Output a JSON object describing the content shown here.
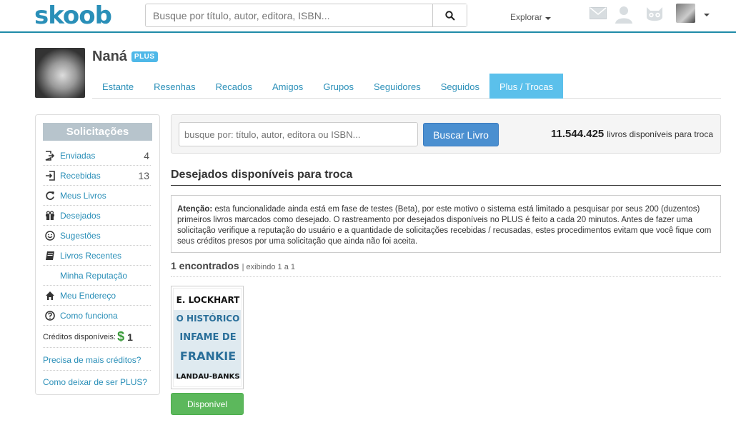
{
  "header": {
    "logo": "skoob",
    "search_placeholder": "Busque por título, autor, editora, ISBN...",
    "explore_label": "Explorar"
  },
  "profile": {
    "name": "Naná",
    "badge": "PLUS",
    "tabs": [
      {
        "label": "Estante"
      },
      {
        "label": "Resenhas"
      },
      {
        "label": "Recados"
      },
      {
        "label": "Amigos"
      },
      {
        "label": "Grupos"
      },
      {
        "label": "Seguidores"
      },
      {
        "label": "Seguidos"
      },
      {
        "label": "Plus / Trocas",
        "active": true
      }
    ]
  },
  "sidebar": {
    "title": "Solicitações",
    "items": [
      {
        "label": "Enviadas",
        "count": "4",
        "icon": "send-icon"
      },
      {
        "label": "Recebidas",
        "count": "13",
        "icon": "receive-icon"
      },
      {
        "label": "Meus Livros",
        "count": "",
        "icon": "refresh-icon"
      },
      {
        "label": "Desejados",
        "count": "",
        "icon": "gift-icon"
      },
      {
        "label": "Sugestões",
        "count": "",
        "icon": "smiley-icon"
      },
      {
        "label": "Livros Recentes",
        "count": "",
        "icon": "book-icon"
      },
      {
        "label": "Minha Reputação",
        "count": "",
        "icon": ""
      },
      {
        "label": "Meu Endereço",
        "count": "",
        "icon": "home-icon"
      },
      {
        "label": "Como funciona",
        "count": "",
        "icon": "question-icon"
      }
    ],
    "credits_label": "Créditos disponíveis:",
    "credits_symbol": "$",
    "credits_value": "1",
    "link_more_credits": "Precisa de mais créditos?",
    "link_cancel_plus": "Como deixar de ser PLUS?"
  },
  "search_panel": {
    "placeholder": "busque por: título, autor, editora ou ISBN...",
    "button_label": "Buscar Livro",
    "available_count": "11.544.425",
    "available_label": "livros disponíveis para troca"
  },
  "main": {
    "section_title": "Desejados disponíveis para troca",
    "notice_bold": "Atenção:",
    "notice_text": "esta funcionalidade ainda está em fase de testes (Beta), por este motivo o sistema está limitado a pesquisar por seus 200 (duzentos) primeiros livros marcados como desejado. O rastreamento por desejados disponíveis no PLUS é feito a cada 20 minutos. Antes de fazer uma solicitação verifique a reputação do usuário e a quantidade de solicitações recebidas / recusadas, estes procedimentos evitam que você fique com seus créditos presos por uma solicitação que ainda não foi aceita.",
    "found_count": "1 encontrados",
    "found_range": "| exibindo 1 a 1"
  },
  "book": {
    "cover_lines": [
      "E. LOCKHART",
      "O HISTÓRICO",
      "INFAME DE",
      "FRANKIE",
      "LANDAU-BANKS"
    ],
    "button_label": "Disponível"
  },
  "colors": {
    "brand": "#2a8fb8",
    "active_tab": "#5bc0eb",
    "primary_button": "#4a8fd0",
    "success_button": "#5cb85c",
    "cover_blue": "#2a6f9a"
  }
}
